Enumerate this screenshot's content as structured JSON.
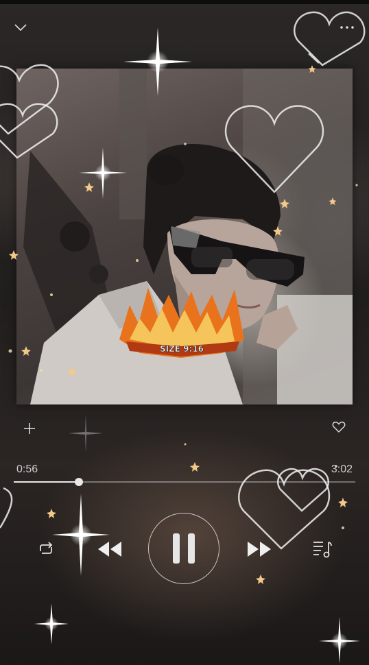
{
  "player": {
    "elapsed": "0:56",
    "duration": "3:02",
    "progress_fraction": 0.19
  },
  "cover": {
    "logo_size_text": "SIZE 9:16"
  },
  "colors": {
    "background": "#221f1e",
    "accent": "#e8e8e8",
    "sticker_fire": "#e8731c"
  },
  "icons": {
    "collapse": "chevron-down-icon",
    "more": "more-dots-icon",
    "add": "plus-icon",
    "favorite": "heart-icon",
    "repeat": "repeat-icon",
    "previous": "rewind-icon",
    "play_state": "pause-icon",
    "next": "fast-forward-icon",
    "queue": "playlist-icon"
  }
}
